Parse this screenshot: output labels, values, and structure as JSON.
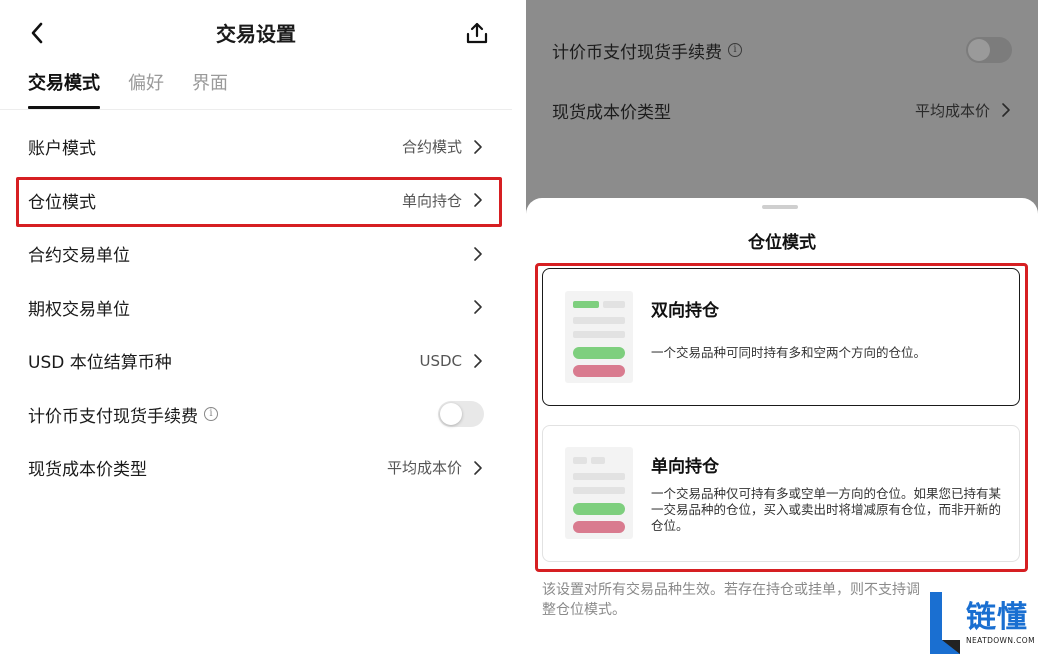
{
  "left": {
    "header": {
      "title": "交易设置",
      "back_icon": "chevron-left-icon",
      "share_icon": "share-icon"
    },
    "tabs": [
      {
        "label": "交易模式",
        "active": true
      },
      {
        "label": "偏好",
        "active": false
      },
      {
        "label": "界面",
        "active": false
      }
    ],
    "rows": [
      {
        "label": "账户模式",
        "value": "合约模式",
        "chevron": true
      },
      {
        "label": "仓位模式",
        "value": "单向持仓",
        "chevron": true,
        "highlighted": true
      },
      {
        "label": "合约交易单位",
        "value": "",
        "chevron": true
      },
      {
        "label": "期权交易单位",
        "value": "",
        "chevron": true
      },
      {
        "label": "USD 本位结算币种",
        "value": "USDC",
        "chevron": true
      },
      {
        "label": "计价币支付现货手续费",
        "info": true,
        "toggle": false
      },
      {
        "label": "现货成本价类型",
        "value": "平均成本价",
        "chevron": true
      }
    ]
  },
  "right": {
    "background_rows": [
      {
        "label": "计价币支付现货手续费",
        "info": true,
        "toggle": false
      },
      {
        "label": "现货成本价类型",
        "value": "平均成本价",
        "chevron": true
      }
    ],
    "sheet": {
      "title": "仓位模式",
      "options": [
        {
          "title": "双向持仓",
          "description": "一个交易品种可同时持有多和空两个方向的仓位。",
          "selected": true
        },
        {
          "title": "单向持仓",
          "description": "一个交易品种仅可持有多或空单一方向的仓位。如果您已持有某一交易品种的仓位，买入或卖出时将增减原有仓位，而非开新的仓位。",
          "selected": false
        }
      ],
      "footnote": "该设置对所有交易品种生效。若存在持仓或挂单，则不支持调整仓位模式。"
    }
  },
  "watermark": {
    "brand": "链懂",
    "sub": "NEATDOWN.COM"
  },
  "colors": {
    "highlight": "#d61f22",
    "green": "#7ecf7e",
    "red": "#d97b8f",
    "overlay": "#8c8c8c"
  }
}
